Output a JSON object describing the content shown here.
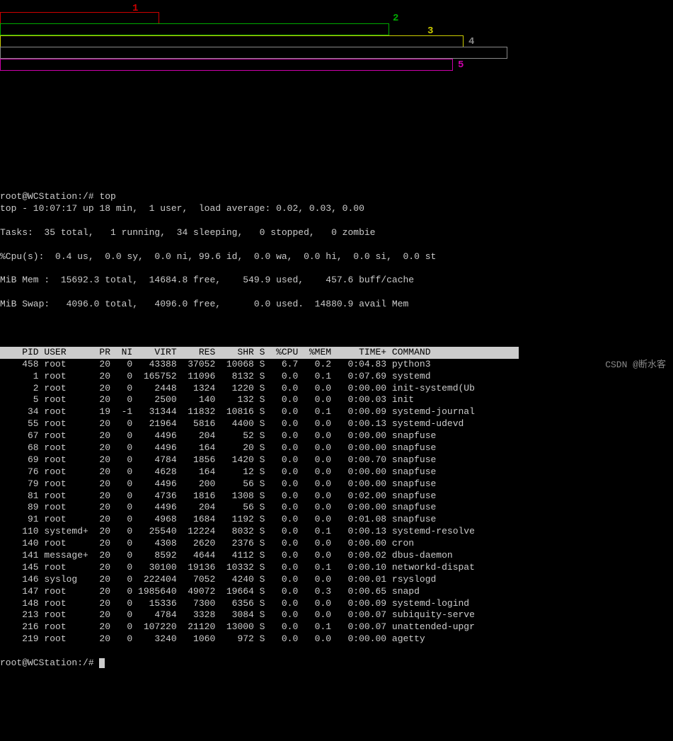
{
  "prompt": {
    "user_host": "root@WCStation",
    "cwd": "/",
    "command": "top"
  },
  "annotations": {
    "a1": "1",
    "a2": "2",
    "a3": "3",
    "a4": "4",
    "a5": "5"
  },
  "summary": {
    "line1": "top - 10:07:17 up 18 min,  1 user,  load average: 0.02, 0.03, 0.00",
    "line2": "Tasks:  35 total,   1 running,  34 sleeping,   0 stopped,   0 zombie",
    "line3": "%Cpu(s):  0.4 us,  0.0 sy,  0.0 ni, 99.6 id,  0.0 wa,  0.0 hi,  0.0 si,  0.0 st",
    "line4": "MiB Mem :  15692.3 total,  14684.8 free,    549.9 used,    457.6 buff/cache",
    "line5": "MiB Swap:   4096.0 total,   4096.0 free,      0.0 used.  14880.9 avail Mem"
  },
  "columns": [
    "PID",
    "USER",
    "PR",
    "NI",
    "VIRT",
    "RES",
    "SHR",
    "S",
    "%CPU",
    "%MEM",
    "TIME+",
    "COMMAND"
  ],
  "header_text": "    PID USER      PR  NI    VIRT    RES    SHR S  %CPU  %MEM     TIME+ COMMAND                ",
  "rows": [
    {
      "pid": "458",
      "user": "root",
      "pr": "20",
      "ni": "0",
      "virt": "43388",
      "res": "37052",
      "shr": "10068",
      "s": "S",
      "cpu": "6.7",
      "mem": "0.2",
      "time": "0:04.83",
      "cmd": "python3"
    },
    {
      "pid": "1",
      "user": "root",
      "pr": "20",
      "ni": "0",
      "virt": "165752",
      "res": "11096",
      "shr": "8132",
      "s": "S",
      "cpu": "0.0",
      "mem": "0.1",
      "time": "0:07.69",
      "cmd": "systemd"
    },
    {
      "pid": "2",
      "user": "root",
      "pr": "20",
      "ni": "0",
      "virt": "2448",
      "res": "1324",
      "shr": "1220",
      "s": "S",
      "cpu": "0.0",
      "mem": "0.0",
      "time": "0:00.00",
      "cmd": "init-systemd(Ub"
    },
    {
      "pid": "5",
      "user": "root",
      "pr": "20",
      "ni": "0",
      "virt": "2500",
      "res": "140",
      "shr": "132",
      "s": "S",
      "cpu": "0.0",
      "mem": "0.0",
      "time": "0:00.03",
      "cmd": "init"
    },
    {
      "pid": "34",
      "user": "root",
      "pr": "19",
      "ni": "-1",
      "virt": "31344",
      "res": "11832",
      "shr": "10816",
      "s": "S",
      "cpu": "0.0",
      "mem": "0.1",
      "time": "0:00.09",
      "cmd": "systemd-journal"
    },
    {
      "pid": "55",
      "user": "root",
      "pr": "20",
      "ni": "0",
      "virt": "21964",
      "res": "5816",
      "shr": "4400",
      "s": "S",
      "cpu": "0.0",
      "mem": "0.0",
      "time": "0:00.13",
      "cmd": "systemd-udevd"
    },
    {
      "pid": "67",
      "user": "root",
      "pr": "20",
      "ni": "0",
      "virt": "4496",
      "res": "204",
      "shr": "52",
      "s": "S",
      "cpu": "0.0",
      "mem": "0.0",
      "time": "0:00.00",
      "cmd": "snapfuse"
    },
    {
      "pid": "68",
      "user": "root",
      "pr": "20",
      "ni": "0",
      "virt": "4496",
      "res": "164",
      "shr": "20",
      "s": "S",
      "cpu": "0.0",
      "mem": "0.0",
      "time": "0:00.00",
      "cmd": "snapfuse"
    },
    {
      "pid": "69",
      "user": "root",
      "pr": "20",
      "ni": "0",
      "virt": "4784",
      "res": "1856",
      "shr": "1420",
      "s": "S",
      "cpu": "0.0",
      "mem": "0.0",
      "time": "0:00.70",
      "cmd": "snapfuse"
    },
    {
      "pid": "76",
      "user": "root",
      "pr": "20",
      "ni": "0",
      "virt": "4628",
      "res": "164",
      "shr": "12",
      "s": "S",
      "cpu": "0.0",
      "mem": "0.0",
      "time": "0:00.00",
      "cmd": "snapfuse"
    },
    {
      "pid": "79",
      "user": "root",
      "pr": "20",
      "ni": "0",
      "virt": "4496",
      "res": "200",
      "shr": "56",
      "s": "S",
      "cpu": "0.0",
      "mem": "0.0",
      "time": "0:00.00",
      "cmd": "snapfuse"
    },
    {
      "pid": "81",
      "user": "root",
      "pr": "20",
      "ni": "0",
      "virt": "4736",
      "res": "1816",
      "shr": "1308",
      "s": "S",
      "cpu": "0.0",
      "mem": "0.0",
      "time": "0:02.00",
      "cmd": "snapfuse"
    },
    {
      "pid": "89",
      "user": "root",
      "pr": "20",
      "ni": "0",
      "virt": "4496",
      "res": "204",
      "shr": "56",
      "s": "S",
      "cpu": "0.0",
      "mem": "0.0",
      "time": "0:00.00",
      "cmd": "snapfuse"
    },
    {
      "pid": "91",
      "user": "root",
      "pr": "20",
      "ni": "0",
      "virt": "4968",
      "res": "1684",
      "shr": "1192",
      "s": "S",
      "cpu": "0.0",
      "mem": "0.0",
      "time": "0:01.08",
      "cmd": "snapfuse"
    },
    {
      "pid": "110",
      "user": "systemd+",
      "pr": "20",
      "ni": "0",
      "virt": "25540",
      "res": "12224",
      "shr": "8032",
      "s": "S",
      "cpu": "0.0",
      "mem": "0.1",
      "time": "0:00.13",
      "cmd": "systemd-resolve"
    },
    {
      "pid": "140",
      "user": "root",
      "pr": "20",
      "ni": "0",
      "virt": "4308",
      "res": "2620",
      "shr": "2376",
      "s": "S",
      "cpu": "0.0",
      "mem": "0.0",
      "time": "0:00.00",
      "cmd": "cron"
    },
    {
      "pid": "141",
      "user": "message+",
      "pr": "20",
      "ni": "0",
      "virt": "8592",
      "res": "4644",
      "shr": "4112",
      "s": "S",
      "cpu": "0.0",
      "mem": "0.0",
      "time": "0:00.02",
      "cmd": "dbus-daemon"
    },
    {
      "pid": "145",
      "user": "root",
      "pr": "20",
      "ni": "0",
      "virt": "30100",
      "res": "19136",
      "shr": "10332",
      "s": "S",
      "cpu": "0.0",
      "mem": "0.1",
      "time": "0:00.10",
      "cmd": "networkd-dispat"
    },
    {
      "pid": "146",
      "user": "syslog",
      "pr": "20",
      "ni": "0",
      "virt": "222404",
      "res": "7052",
      "shr": "4240",
      "s": "S",
      "cpu": "0.0",
      "mem": "0.0",
      "time": "0:00.01",
      "cmd": "rsyslogd"
    },
    {
      "pid": "147",
      "user": "root",
      "pr": "20",
      "ni": "0",
      "virt": "1985640",
      "res": "49072",
      "shr": "19664",
      "s": "S",
      "cpu": "0.0",
      "mem": "0.3",
      "time": "0:00.65",
      "cmd": "snapd"
    },
    {
      "pid": "148",
      "user": "root",
      "pr": "20",
      "ni": "0",
      "virt": "15336",
      "res": "7300",
      "shr": "6356",
      "s": "S",
      "cpu": "0.0",
      "mem": "0.0",
      "time": "0:00.09",
      "cmd": "systemd-logind"
    },
    {
      "pid": "213",
      "user": "root",
      "pr": "20",
      "ni": "0",
      "virt": "4784",
      "res": "3328",
      "shr": "3084",
      "s": "S",
      "cpu": "0.0",
      "mem": "0.0",
      "time": "0:00.07",
      "cmd": "subiquity-serve"
    },
    {
      "pid": "216",
      "user": "root",
      "pr": "20",
      "ni": "0",
      "virt": "107220",
      "res": "21120",
      "shr": "13000",
      "s": "S",
      "cpu": "0.0",
      "mem": "0.1",
      "time": "0:00.07",
      "cmd": "unattended-upgr"
    },
    {
      "pid": "219",
      "user": "root",
      "pr": "20",
      "ni": "0",
      "virt": "3240",
      "res": "1060",
      "shr": "972",
      "s": "S",
      "cpu": "0.0",
      "mem": "0.0",
      "time": "0:00.00",
      "cmd": "agetty"
    }
  ],
  "watermark": "CSDN @断水客"
}
